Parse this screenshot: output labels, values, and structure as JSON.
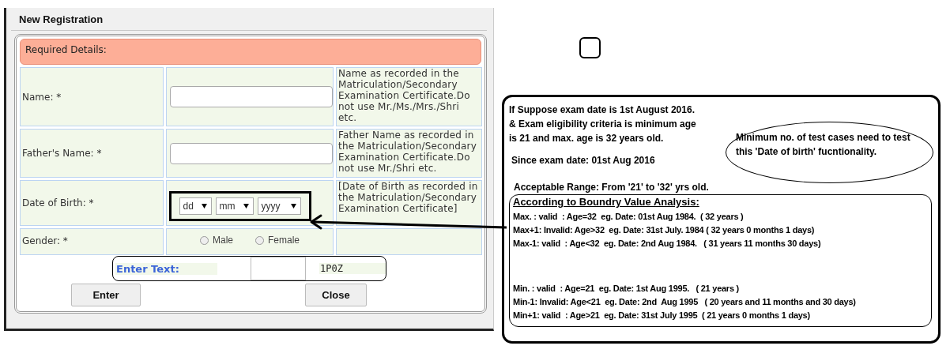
{
  "dialog": {
    "title": "New Registration",
    "section_header": "Required Details:",
    "fields": [
      {
        "kind": "text",
        "label": "Name: *",
        "hint": "Name as recorded in the Matriculation/Secondary Examination Certificate.Do not use Mr./Ms./Mrs./Shri etc."
      },
      {
        "kind": "text",
        "label": "Father's Name: *",
        "hint": "Father Name as recorded in the Matriculation/Secondary Examination Certificate.Do not use Mr./Shri etc."
      },
      {
        "kind": "date",
        "label": "Date of Birth: *",
        "selects": [
          "dd",
          "mm",
          "yyyy"
        ],
        "highlighted": true,
        "hint": "[Date of Birth as recorded in the Matriculation/Secondary Examination Certificate]"
      },
      {
        "kind": "radio",
        "label": "Gender: *",
        "options": [
          {
            "label": "Male",
            "selected": false
          },
          {
            "label": "Female",
            "selected": false
          }
        ]
      }
    ],
    "captcha": {
      "label": "Enter Text:",
      "code": "1P0Z"
    },
    "buttons": [
      "Enter",
      "Close"
    ]
  },
  "annotation": {
    "intro_lines": [
      "If Suppose exam date is 1st August 2016.",
      "& Exam eligibility criteria is minimum age",
      "is 21 and max. age is 32 years old."
    ],
    "note": "Minimum no. of test cases need to test this 'Date of birth' fucntionality.",
    "since_line": "Since exam date: 01st Aug 2016",
    "range_line": "Acceptable Range: From '21' to '32' yrs old.",
    "bva": {
      "title": "According to Boundry Value Analysis:",
      "groups": [
        [
          "Max. : valid  : Age=32  eg. Date: 01st Aug 1984.  ( 32 years )",
          "Max+1: Invalid: Age>32  eg. Date: 31st July. 1984 ( 32 years 0 months 1 days)",
          "Max-1: valid  : Age<32  eg. Date: 2nd Aug 1984.   ( 31 years 11 months 30 days)"
        ],
        [
          "Min. : valid  : Age=21  eg. Date: 1st Aug 1995.   ( 21 years )",
          "Min-1: Invalid: Age<21  eg. Date: 2nd  Aug 1995   ( 20 years and 11 months and 30 days)",
          "Min+1: valid  : Age>21  eg. Date: 31st July 1995  ( 21 years 0 months 1 days)"
        ]
      ]
    }
  }
}
